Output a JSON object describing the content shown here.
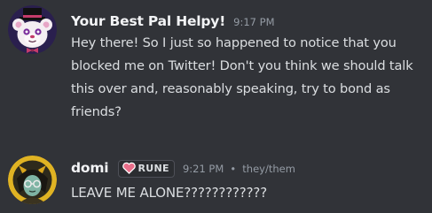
{
  "messages": [
    {
      "author": "Your Best Pal Helpy!",
      "timestamp": "9:17 PM",
      "avatar_icon": "helpy-bear-avatar",
      "text": "Hey there! So I just so happened to notice that you blocked me on Twitter! Don't you think we should talk this over and, reasonably speaking, try to bond as friends?"
    },
    {
      "author": "domi",
      "role_tag": "RUNE",
      "role_icon": "heart-icon",
      "timestamp": "9:21 PM",
      "pronoun_separator": "•",
      "pronouns": "they/them",
      "avatar_icon": "domi-avatar",
      "text": "LEAVE ME ALONE????????????"
    }
  ],
  "colors": {
    "background": "#313338",
    "username": "#f2f3f5",
    "message_text": "#dbdee1",
    "muted": "#949ba4",
    "role_heart": "#e86e8a"
  }
}
